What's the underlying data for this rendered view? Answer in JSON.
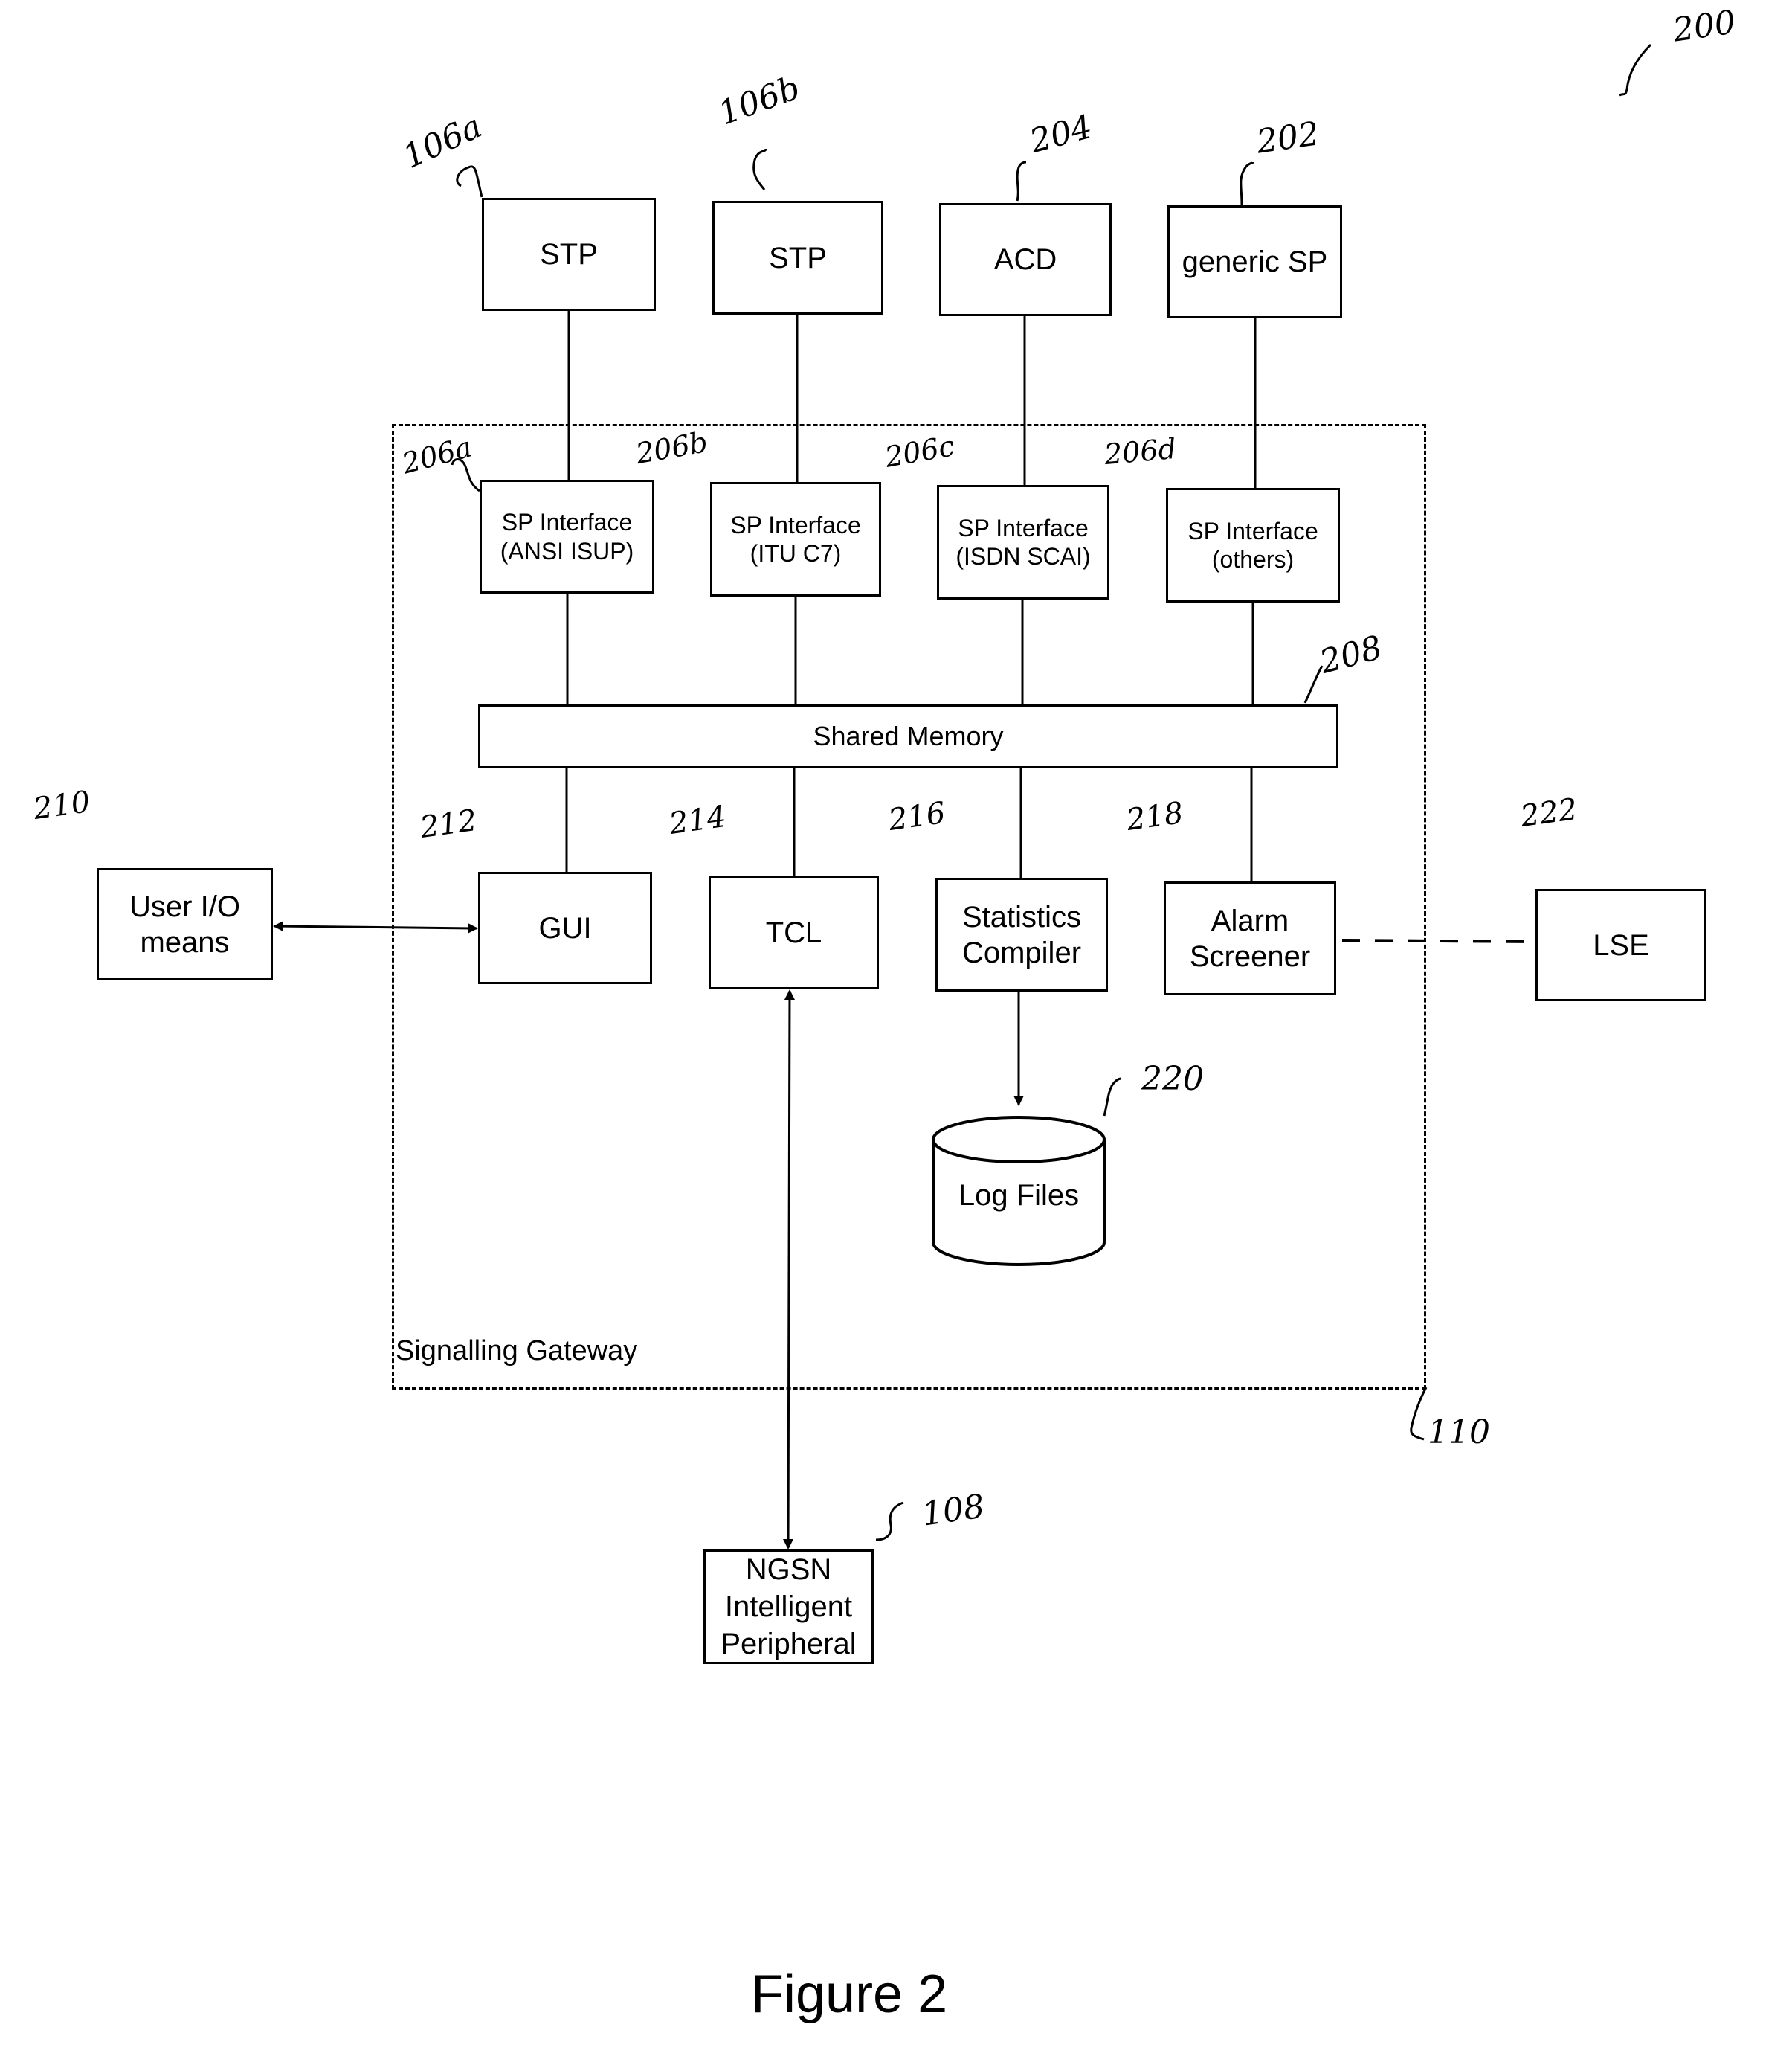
{
  "figure": {
    "caption": "Figure 2",
    "reference": "200"
  },
  "boundary": {
    "label": "Signalling Gateway",
    "reference": "110"
  },
  "external_nodes": [
    {
      "id": "stp-a",
      "label": "STP",
      "reference": "106a"
    },
    {
      "id": "stp-b",
      "label": "STP",
      "reference": "106b"
    },
    {
      "id": "acd",
      "label": "ACD",
      "reference": "204"
    },
    {
      "id": "generic-sp",
      "label": "generic SP",
      "reference": "202"
    }
  ],
  "sp_interfaces": [
    {
      "id": "sp-ansi",
      "line1": "SP Interface",
      "line2": "(ANSI ISUP)",
      "reference": "206a"
    },
    {
      "id": "sp-itu",
      "line1": "SP Interface",
      "line2": "(ITU C7)",
      "reference": "206b"
    },
    {
      "id": "sp-isdn",
      "line1": "SP Interface",
      "line2": "(ISDN SCAI)",
      "reference": "206c"
    },
    {
      "id": "sp-others",
      "line1": "SP Interface",
      "line2": "(others)",
      "reference": "206d"
    }
  ],
  "shared_memory": {
    "label": "Shared Memory",
    "reference": "208"
  },
  "modules": [
    {
      "id": "gui",
      "line1": "GUI",
      "line2": "",
      "reference": "212"
    },
    {
      "id": "tcl",
      "line1": "TCL",
      "line2": "",
      "reference": "214"
    },
    {
      "id": "stats",
      "line1": "Statistics",
      "line2": "Compiler",
      "reference": "216"
    },
    {
      "id": "alarm",
      "line1": "Alarm",
      "line2": "Screener",
      "reference": "218"
    }
  ],
  "user_io": {
    "line1": "User I/O",
    "line2": "means",
    "reference": "210"
  },
  "lse": {
    "label": "LSE",
    "reference": "222"
  },
  "log_files": {
    "label": "Log Files",
    "reference": "220"
  },
  "ngsn": {
    "line1": "NGSN",
    "line2": "Intelligent",
    "line3": "Peripheral",
    "reference": "108"
  },
  "connections": [
    {
      "from": "STP (106a)",
      "to": "SP Interface (ANSI ISUP)",
      "style": "solid"
    },
    {
      "from": "STP (106b)",
      "to": "SP Interface (ITU C7)",
      "style": "solid"
    },
    {
      "from": "ACD",
      "to": "SP Interface (ISDN SCAI)",
      "style": "solid"
    },
    {
      "from": "generic SP",
      "to": "SP Interface (others)",
      "style": "solid"
    },
    {
      "from": "SP Interfaces",
      "to": "Shared Memory",
      "style": "solid"
    },
    {
      "from": "Shared Memory",
      "to": "GUI / TCL / Statistics Compiler / Alarm Screener",
      "style": "solid"
    },
    {
      "from": "User I/O means",
      "to": "GUI",
      "style": "bidirectional-arrow"
    },
    {
      "from": "TCL",
      "to": "NGSN Intelligent Peripheral",
      "style": "bidirectional-arrow"
    },
    {
      "from": "Statistics Compiler",
      "to": "Log Files",
      "style": "arrow"
    },
    {
      "from": "Alarm Screener",
      "to": "LSE",
      "style": "dashed"
    }
  ]
}
